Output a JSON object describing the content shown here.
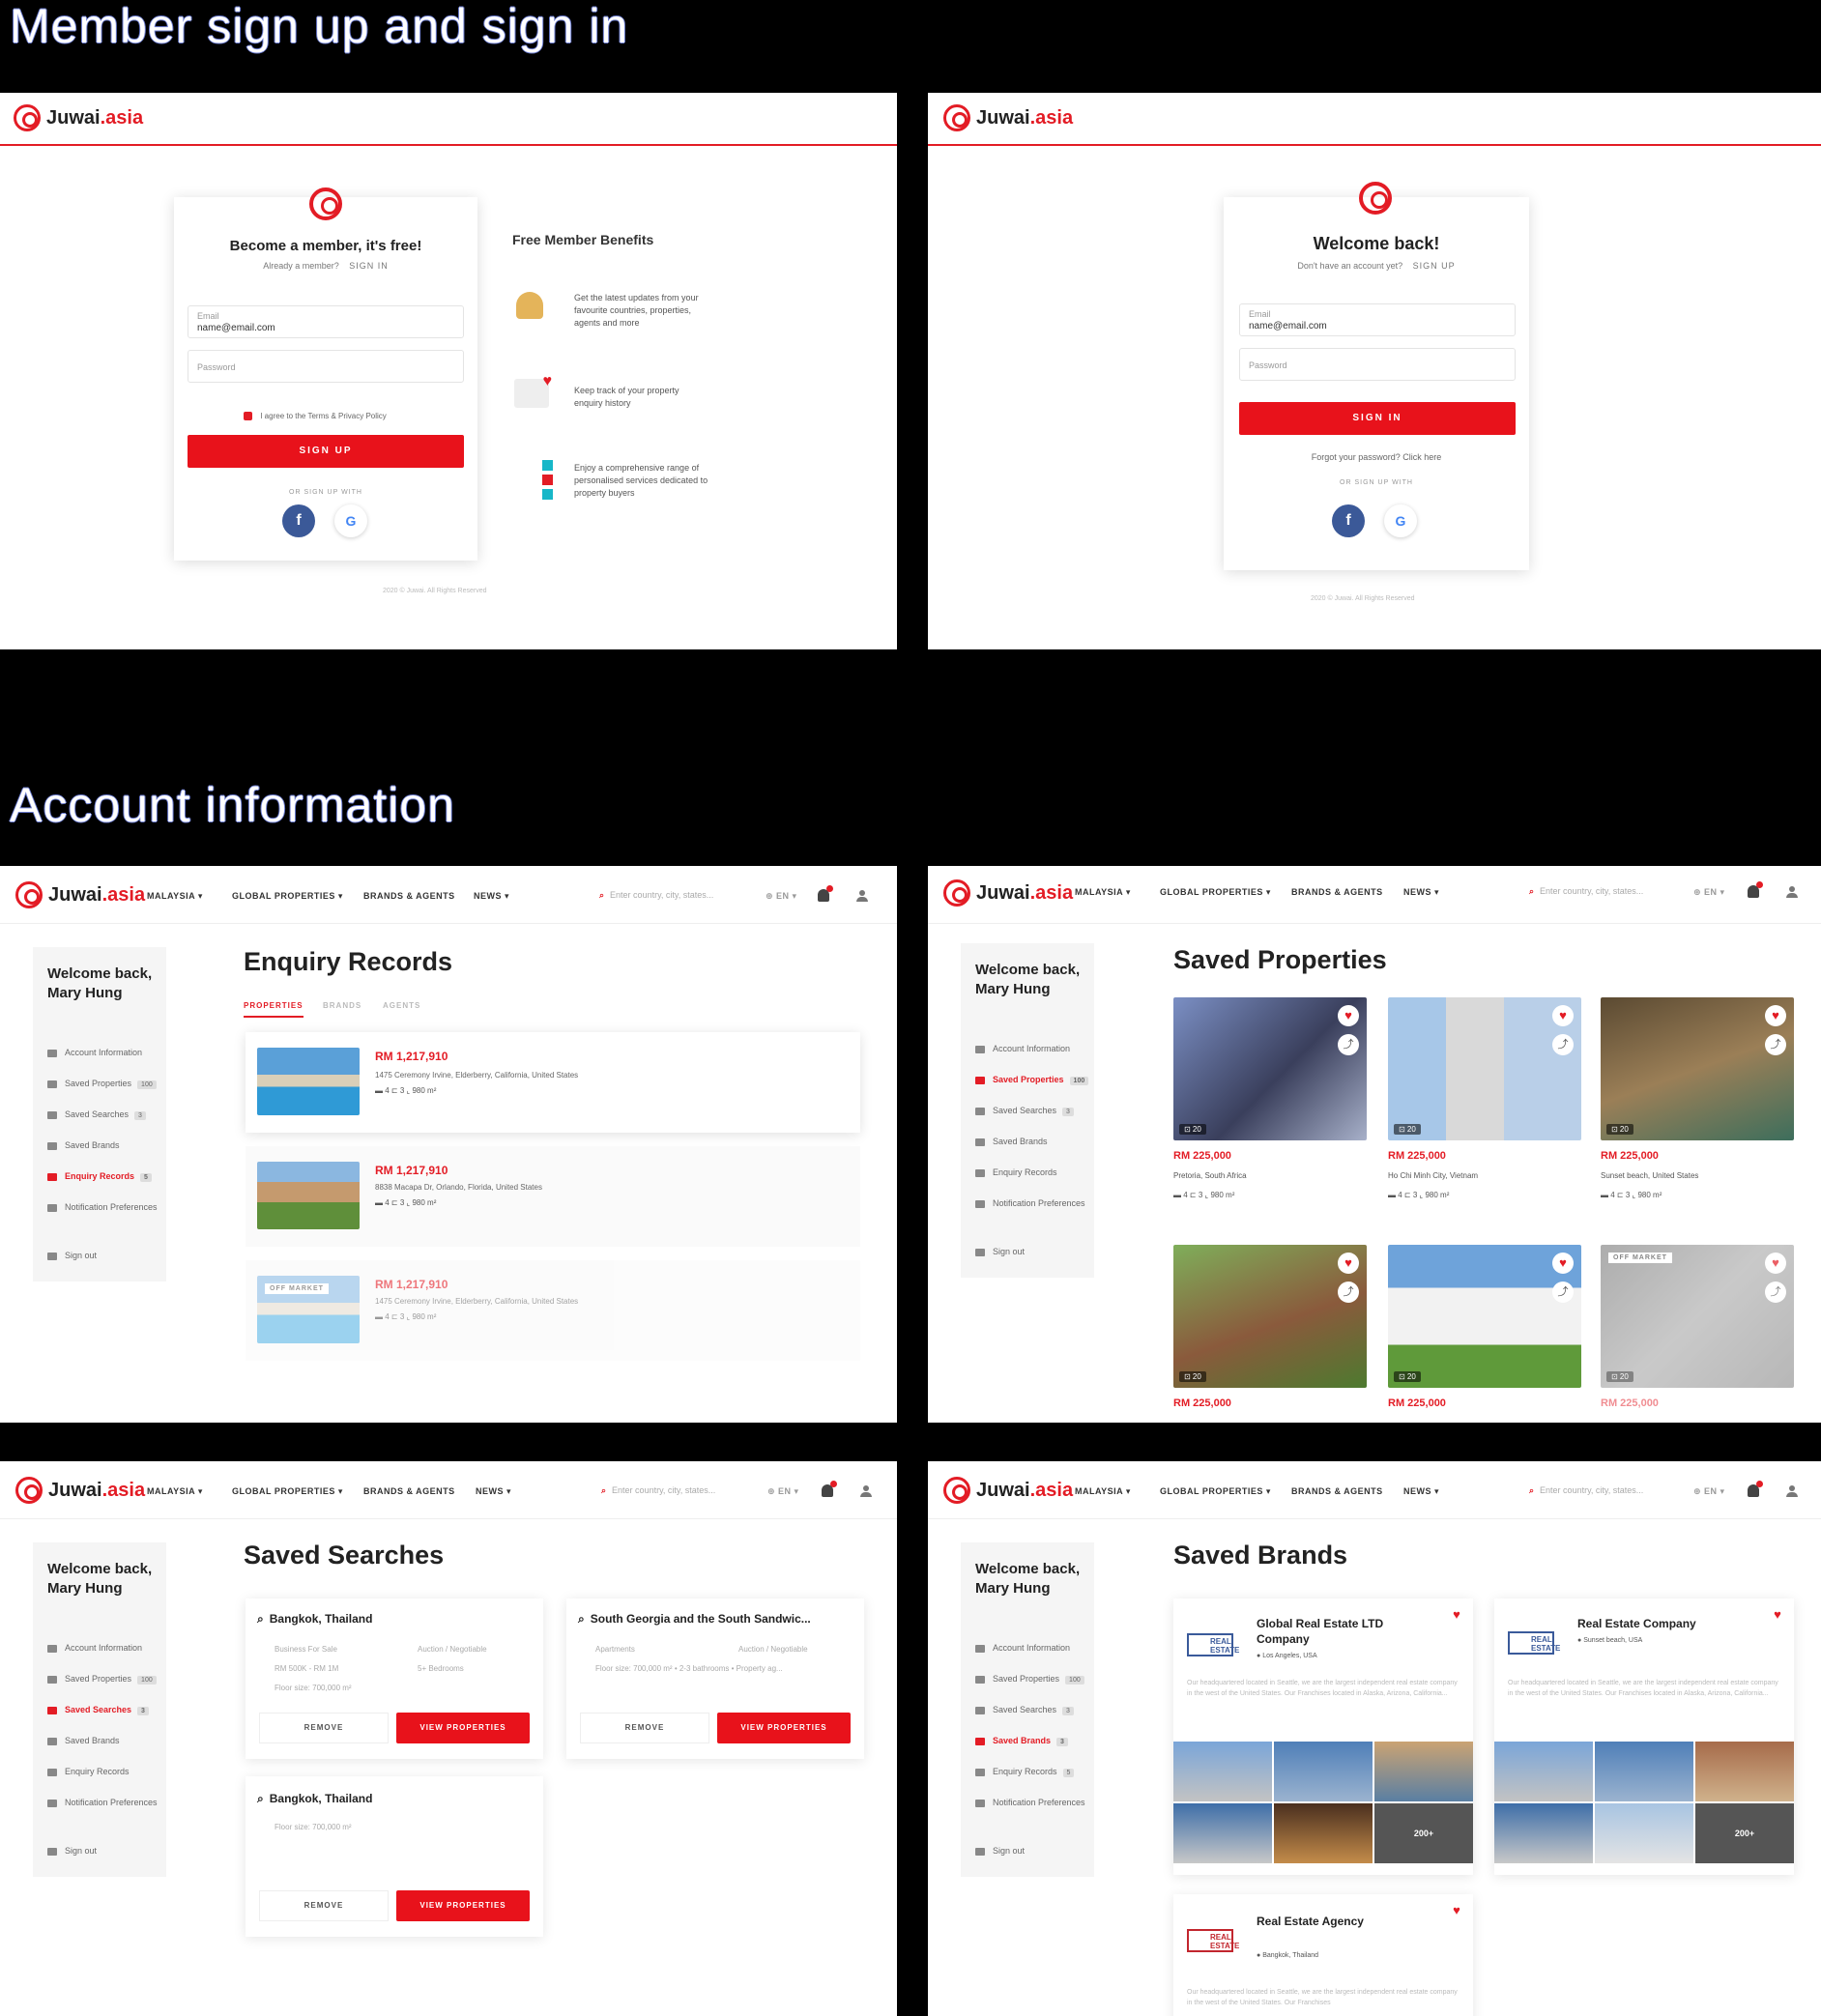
{
  "sections": {
    "signup": "Member sign up and sign in",
    "account": "Account information"
  },
  "brand": {
    "name": "Juwai",
    "suffix": ".asia",
    "accent": "#e31c25"
  },
  "signup": {
    "title": "Become a member, it's free!",
    "already": "Already a member?",
    "signin_link": "SIGN IN",
    "email_label": "Email",
    "email_value": "name@email.com",
    "password_label": "Password",
    "agree": "I agree to the Terms & Privacy Policy",
    "button": "SIGN UP",
    "or": "OR SIGN UP WITH",
    "benefits_title": "Free Member Benefits",
    "benefits": [
      "Get the latest updates from your favourite countries, properties, agents and more",
      "Keep track of your property enquiry history",
      "Enjoy a comprehensive range of personalised services dedicated to property buyers"
    ],
    "footer": "2020 © Juwai. All Rights Reserved"
  },
  "signin": {
    "title": "Welcome back!",
    "noaccount": "Don't have an account yet?",
    "signup_link": "SIGN UP",
    "email_label": "Email",
    "email_value": "name@email.com",
    "password_label": "Password",
    "button": "SIGN IN",
    "forgot": "Forgot your password? Click here",
    "or": "OR SIGN UP WITH",
    "footer": "2020 © Juwai. All Rights Reserved"
  },
  "nav": {
    "country": "MALAYSIA ▾",
    "global": "GLOBAL PROPERTIES ▾",
    "brands": "BRANDS & AGENTS",
    "news": "NEWS ▾",
    "search_placeholder": "Enter country, city, states...",
    "lang": "⊕ EN ▾"
  },
  "sidebar": {
    "welcome": "Welcome back, Mary Hung",
    "items": [
      "Account Information",
      "Saved Properties",
      "Saved Searches",
      "Saved Brands",
      "Enquiry Records",
      "Notification Preferences"
    ],
    "signout": "Sign out",
    "counts": {
      "props": "100",
      "searches": "3",
      "brands": "3",
      "enquiry": "5"
    }
  },
  "enquiry": {
    "title": "Enquiry Records",
    "tabs": [
      "PROPERTIES",
      "BRANDS",
      "AGENTS"
    ],
    "items": [
      {
        "price": "RM 1,217,910",
        "addr": "1475 Ceremony Irvine, Elderberry, California, United States",
        "feat": "▬ 4    ⊏ 3    ⌞ 980 m²"
      },
      {
        "price": "RM 1,217,910",
        "addr": "8838 Macapa Dr, Orlando, Florida, United States",
        "feat": "▬ 4    ⊏ 3    ⌞ 980 m²"
      },
      {
        "price": "RM 1,217,910",
        "addr": "1475 Ceremony Irvine, Elderberry, California, United States",
        "feat": "▬ 4    ⊏ 3    ⌞ 980 m²",
        "badge": "OFF MARKET"
      }
    ]
  },
  "saved_props": {
    "title": "Saved Properties",
    "items": [
      {
        "price": "RM 225,000",
        "loc": "Pretoria, South Africa",
        "feat": "▬ 4    ⊏ 3    ⌞ 980 m²",
        "photos": "⊡ 20"
      },
      {
        "price": "RM 225,000",
        "loc": "Ho Chi Minh City, Vietnam",
        "feat": "▬ 4    ⊏ 3    ⌞ 980 m²",
        "photos": "⊡ 20"
      },
      {
        "price": "RM 225,000",
        "loc": "Sunset beach, United States",
        "feat": "▬ 4    ⊏ 3    ⌞ 980 m²",
        "photos": "⊡ 20"
      },
      {
        "price": "RM 225,000",
        "photos": "⊡ 20"
      },
      {
        "price": "RM 225,000",
        "photos": "⊡ 20"
      },
      {
        "price": "RM 225,000",
        "photos": "⊡ 20",
        "badge": "OFF MARKET"
      }
    ]
  },
  "saved_searches": {
    "title": "Saved Searches",
    "remove": "REMOVE",
    "view": "VIEW PROPERTIES",
    "items": [
      {
        "title": "Bangkok, Thailand",
        "d1": "Business For Sale",
        "d2": "Auction / Negotiable",
        "d3": "RM 500K - RM 1M",
        "d4": "5+ Bedrooms",
        "d5": "Floor size: 700,000 m²"
      },
      {
        "title": "South Georgia and the South Sandwic...",
        "d1": "Apartments",
        "d2": "Auction / Negotiable",
        "d5": "Floor size: 700,000 m² • 2-3 bathrooms • Property ag..."
      },
      {
        "title": "Bangkok, Thailand",
        "d5": "Floor size: 700,000 m²"
      }
    ]
  },
  "saved_brands": {
    "title": "Saved Brands",
    "logo": "REAL ESTATE",
    "items": [
      {
        "name": "Global Real Estate LTD Company",
        "loc": "Los Angeles, USA",
        "desc": "Our headquartered located in Seattle, we are the largest independent real estate company in the west of the United States. Our Franchises located in Alaska, Arizona, California...",
        "more": "200+"
      },
      {
        "name": "Real Estate Company",
        "loc": "Sunset beach, USA",
        "desc": "Our headquartered located in Seattle, we are the largest independent real estate company in the west of the United States. Our Franchises located in Alaska, Arizona, California...",
        "more": "200+"
      },
      {
        "name": "Real Estate Agency",
        "loc": "Bangkok, Thailand",
        "desc": "Our headquartered located in Seattle, we are the largest independent real estate company in the west of the United States. Our Franchises"
      }
    ]
  }
}
